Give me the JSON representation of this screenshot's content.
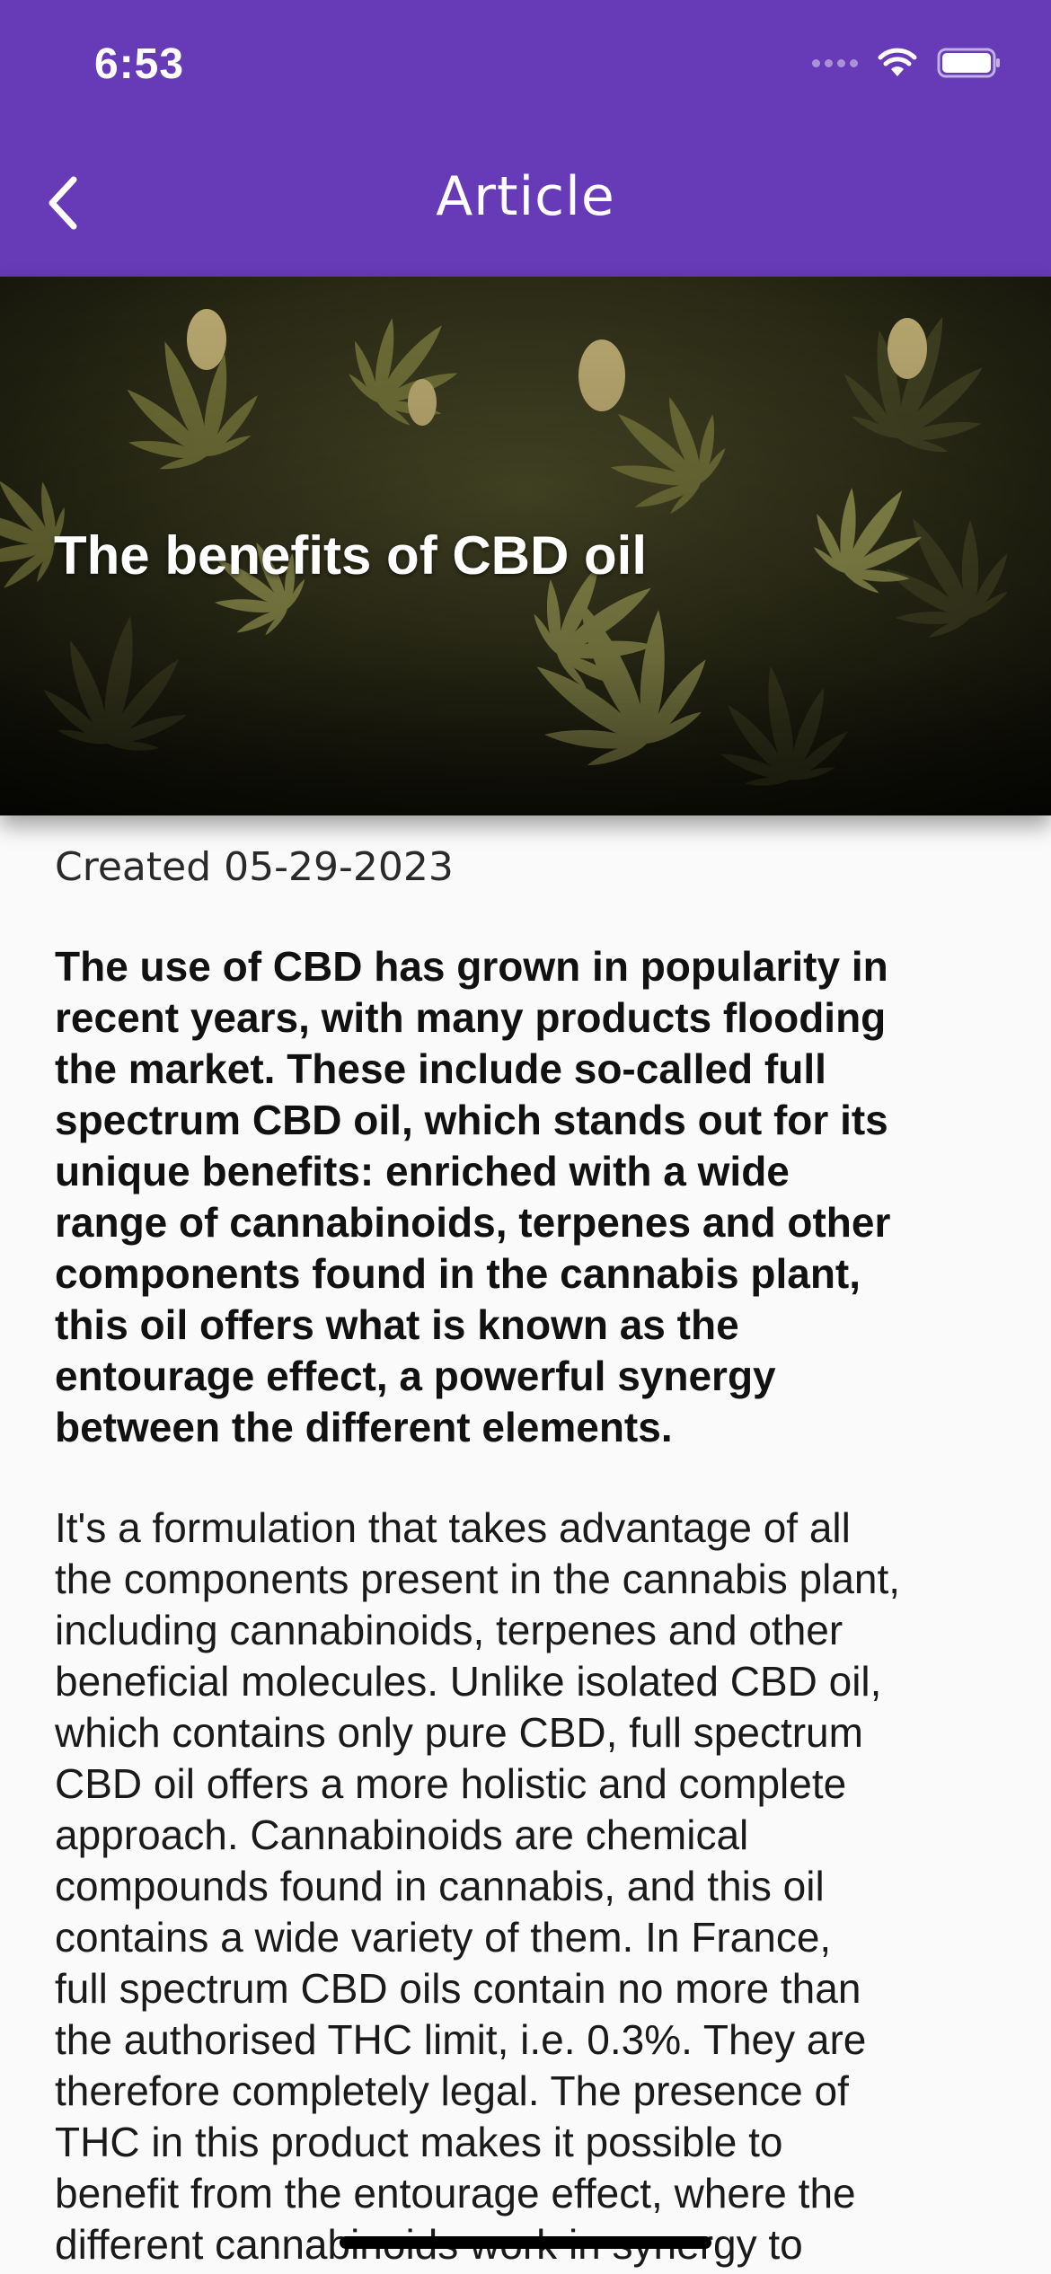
{
  "status_bar": {
    "time": "6:53"
  },
  "app_bar": {
    "title": "Article",
    "back_icon": "chevron-left-icon"
  },
  "article": {
    "title": "The benefits of CBD oil",
    "created": "Created 05-29-2023",
    "lead": "The use of CBD has grown in popularity in\nrecent years, with many products flooding\nthe market. These include so-called full\nspectrum CBD oil, which stands out for its\nunique benefits: enriched with a wide\nrange of cannabinoids, terpenes and other\ncomponents found in the cannabis plant,\nthis oil offers what is known as the\nentourage effect, a powerful synergy\nbetween the different elements.",
    "body": "It's a formulation that takes advantage of all\nthe components present in the cannabis plant,\nincluding cannabinoids, terpenes and other\nbeneficial molecules. Unlike isolated CBD oil,\nwhich contains only pure CBD, full spectrum\nCBD oil offers a more holistic and complete\napproach. Cannabinoids are chemical\ncompounds found in cannabis, and this oil\ncontains a wide variety of them.  In France,\nfull spectrum CBD oils contain no more than\nthe authorised THC limit, i.e. 0.3%. They are\ntherefore completely legal. The presence of\nTHC in this product makes it possible to\nbenefit from the entourage effect, where the\ndifferent cannabinoids work in synergy to"
  },
  "colors": {
    "primary": "#673ab7",
    "background": "#fafafa"
  }
}
